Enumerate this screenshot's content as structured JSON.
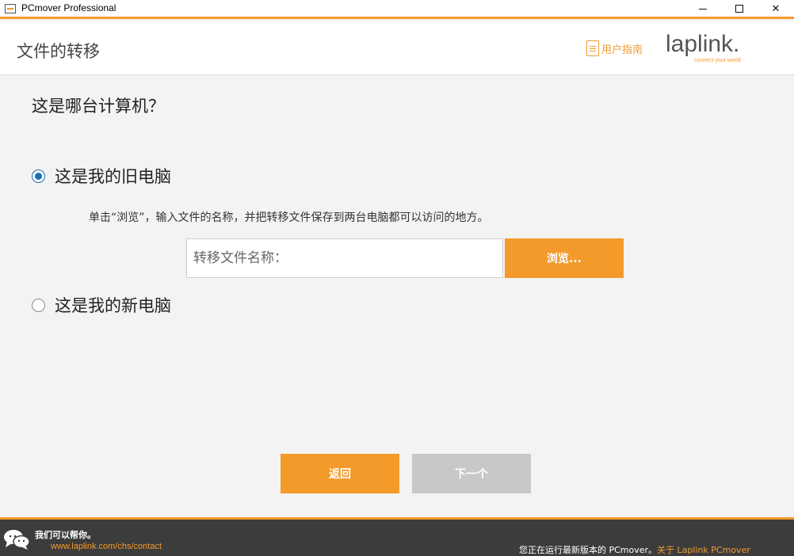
{
  "window": {
    "title": "PCmover Professional"
  },
  "header": {
    "page_title": "文件的转移",
    "guide_label": "用户指南",
    "logo_text": "laplink.",
    "logo_tagline": "connect your world"
  },
  "main": {
    "question": "这是哪台计算机？",
    "options": [
      {
        "label": "这是我的旧电脑",
        "checked": true
      },
      {
        "label": "这是我的新电脑",
        "checked": false
      }
    ],
    "hint": "单击“浏览”，输入文件的名称，并把转移文件保存到两台电脑都可以访问的地方。",
    "file_input": {
      "placeholder": "转移文件名称：",
      "value": ""
    },
    "browse_label": "浏览..."
  },
  "navigation": {
    "back_label": "返回",
    "next_label": "下一个"
  },
  "footer": {
    "help_text": "我们可以帮你。",
    "contact_link": "www.laplink.com/chs/contact",
    "version_text": "您正在运行最新版本的 PCmover。",
    "about_link": "关于 Laplink PCmover Professional"
  },
  "colors": {
    "accent": "#f39a2b",
    "radio_selected": "#1a6fb5",
    "disabled_button": "#c8c8c8",
    "footer_bg": "#3c3c3c"
  }
}
